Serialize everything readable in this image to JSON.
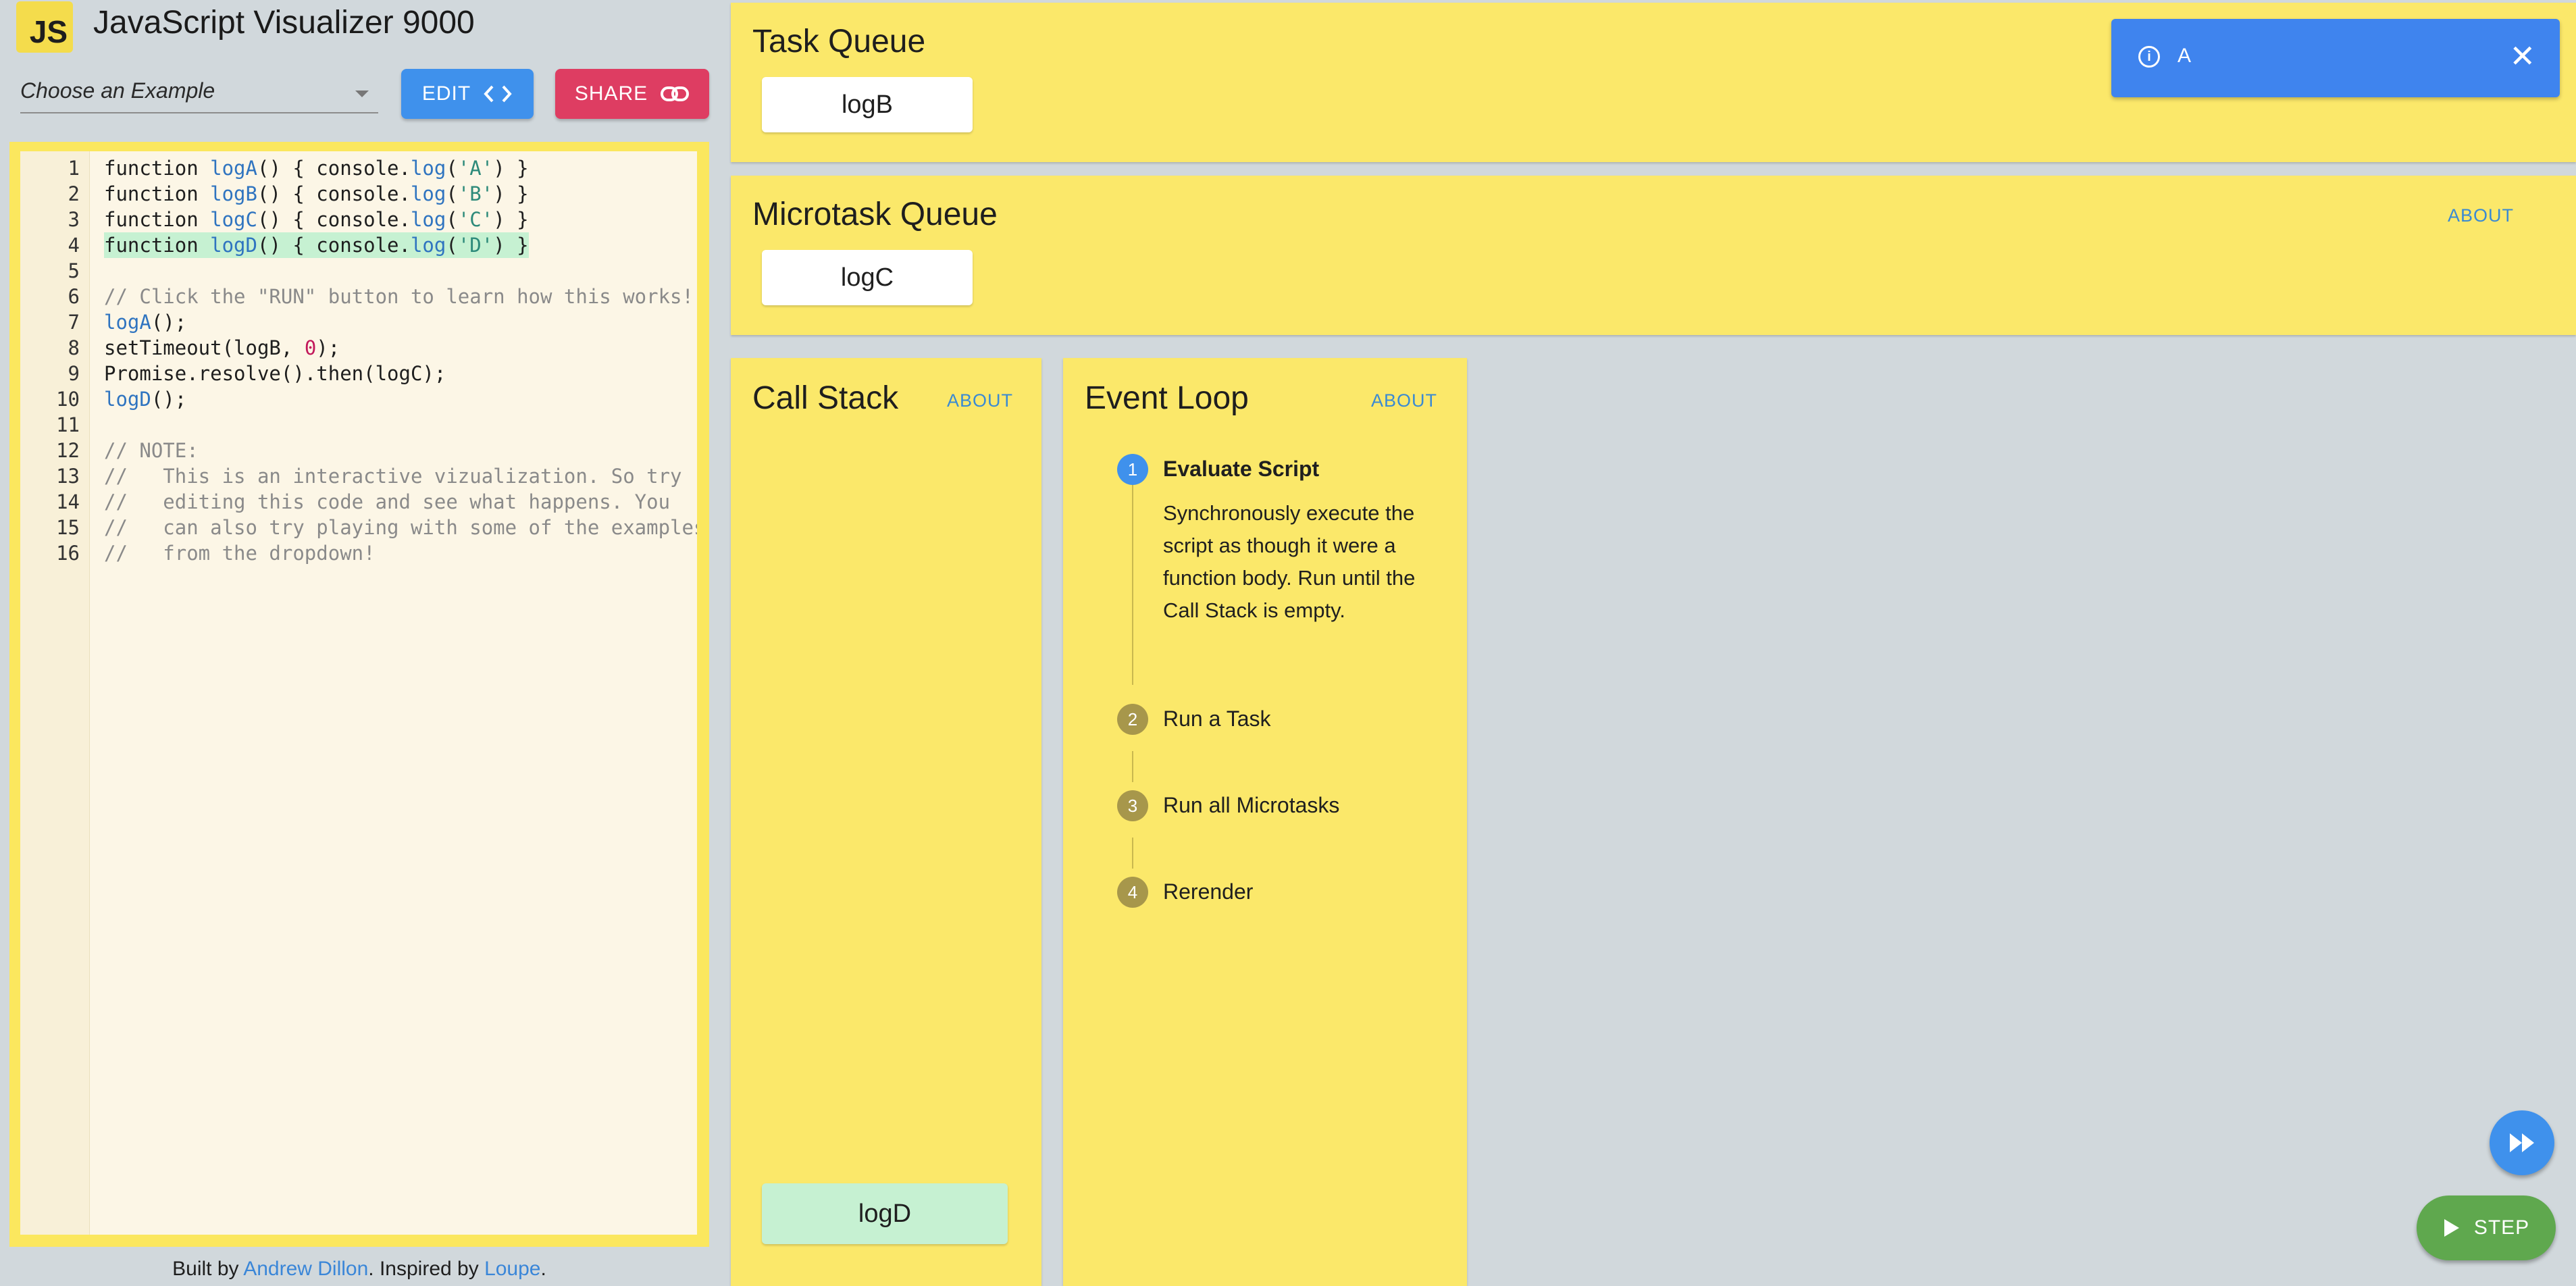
{
  "app": {
    "logo_text": "JS",
    "title": "JavaScript Visualizer 9000"
  },
  "toolbar": {
    "example_placeholder": "Choose an Example",
    "edit_label": "EDIT",
    "share_label": "SHARE"
  },
  "editor": {
    "lines": [
      {
        "n": "1",
        "text": "function logA() { console.log('A') }"
      },
      {
        "n": "2",
        "text": "function logB() { console.log('B') }"
      },
      {
        "n": "3",
        "text": "function logC() { console.log('C') }"
      },
      {
        "n": "4",
        "text": "function logD() { console.log('D') }"
      },
      {
        "n": "5",
        "text": ""
      },
      {
        "n": "6",
        "text": "// Click the \"RUN\" button to learn how this works!"
      },
      {
        "n": "7",
        "text": "logA();"
      },
      {
        "n": "8",
        "text": "setTimeout(logB, 0);"
      },
      {
        "n": "9",
        "text": "Promise.resolve().then(logC);"
      },
      {
        "n": "10",
        "text": "logD();"
      },
      {
        "n": "11",
        "text": ""
      },
      {
        "n": "12",
        "text": "// NOTE:"
      },
      {
        "n": "13",
        "text": "//   This is an interactive vizualization. So try"
      },
      {
        "n": "14",
        "text": "//   editing this code and see what happens. You"
      },
      {
        "n": "15",
        "text": "//   can also try playing with some of the examples"
      },
      {
        "n": "16",
        "text": "//   from the dropdown!"
      }
    ],
    "highlighted_line": "4",
    "cursor_line": "13"
  },
  "footer": {
    "built_by": "Built by ",
    "author": "Andrew Dillon",
    "inspired": ". Inspired by ",
    "inspiration": "Loupe",
    "end": "."
  },
  "task_queue": {
    "title": "Task Queue",
    "items": [
      "logB"
    ]
  },
  "microtask_queue": {
    "title": "Microtask Queue",
    "about": "ABOUT",
    "items": [
      "logC"
    ]
  },
  "call_stack": {
    "title": "Call Stack",
    "about": "ABOUT",
    "items": [
      "logD"
    ]
  },
  "event_loop": {
    "title": "Event Loop",
    "about": "ABOUT",
    "steps": [
      {
        "n": "1",
        "label": "Evaluate Script",
        "active": true
      },
      {
        "n": "2",
        "label": "Run a Task",
        "active": false
      },
      {
        "n": "3",
        "label": "Run all Microtasks",
        "active": false
      },
      {
        "n": "4",
        "label": "Rerender",
        "active": false
      }
    ],
    "active_description": "Synchronously execute the script as though it were a function body. Run until the Call Stack is empty."
  },
  "toast": {
    "message": "A",
    "icon": "info-icon"
  },
  "controls": {
    "fast_forward_icon": "fast-forward-icon",
    "step_label": "STEP"
  },
  "colors": {
    "panel": "#fbe86a",
    "accent_blue": "#3f91ec",
    "share_red": "#de3d62",
    "step_green": "#5fa84e",
    "highlight": "#c6f1d2"
  }
}
